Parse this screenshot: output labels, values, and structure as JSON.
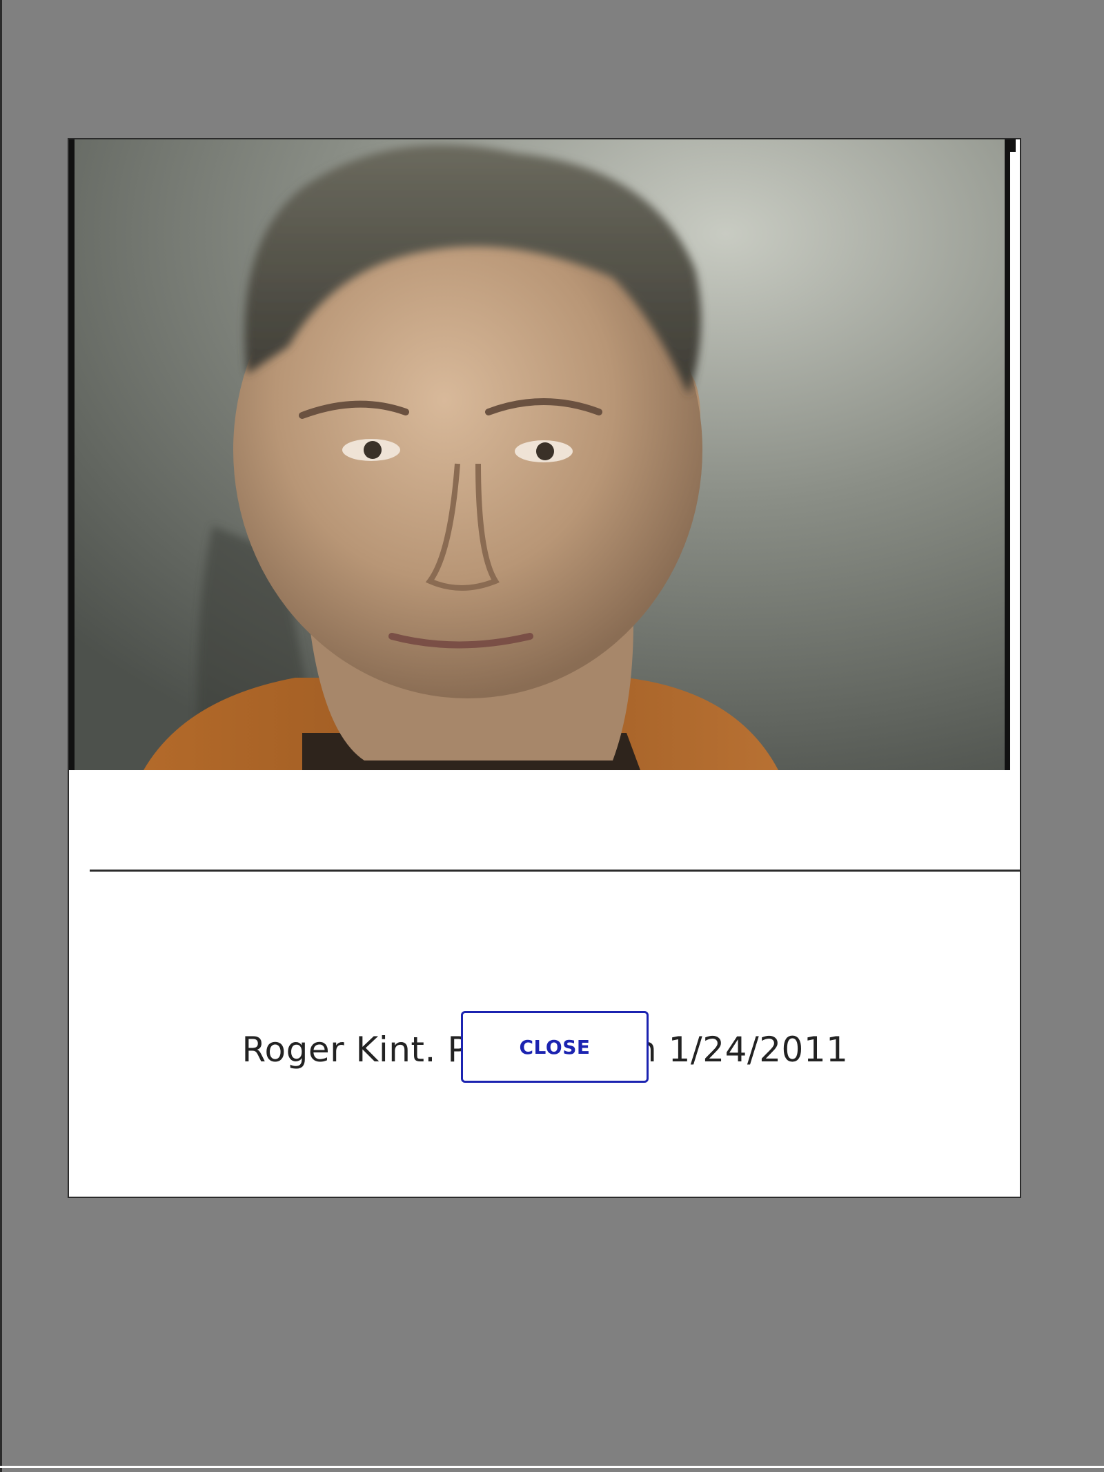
{
  "modal": {
    "photo": {
      "subject": "mugshot of a man in an orange jumpsuit against a grey wall"
    },
    "caption": "Roger Kint. Photo taken 1/24/2011",
    "close_label": "CLOSE"
  },
  "colors": {
    "overlay": "#808080",
    "modal_background": "#ffffff",
    "caption_text": "#222222",
    "button_accent": "#1b23b0"
  }
}
